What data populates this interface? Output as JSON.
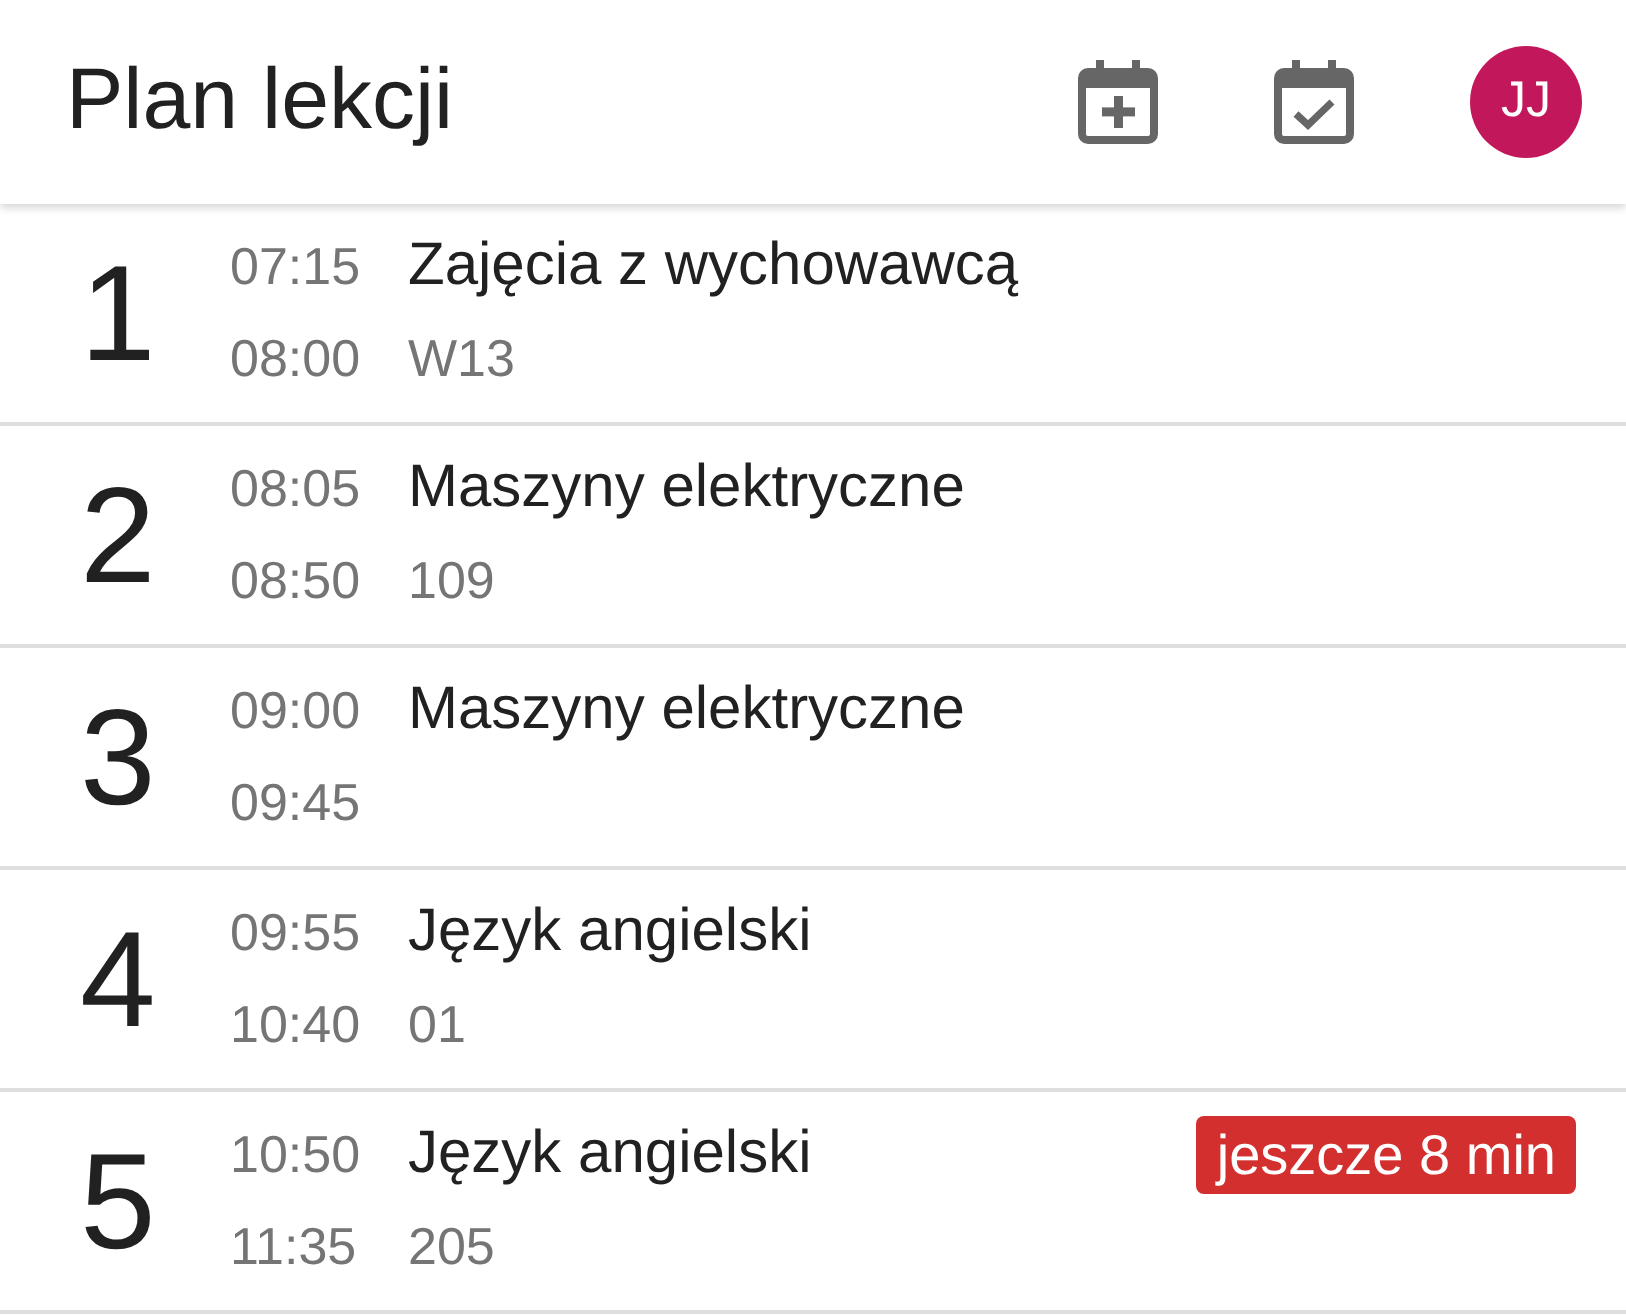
{
  "app_bar": {
    "title": "Plan lekcji",
    "avatar": {
      "initials": "JJ"
    }
  },
  "lessons": [
    {
      "number": "1",
      "start": "07:15",
      "end": "08:00",
      "subject": "Zajęcia z wychowawcą",
      "room": "W13"
    },
    {
      "number": "2",
      "start": "08:05",
      "end": "08:50",
      "subject": "Maszyny elektryczne",
      "room": "109"
    },
    {
      "number": "3",
      "start": "09:00",
      "end": "09:45",
      "subject": "Maszyny elektryczne"
    },
    {
      "number": "4",
      "start": "09:55",
      "end": "10:40",
      "subject": "Język angielski",
      "room": "01"
    },
    {
      "number": "5",
      "start": "10:50",
      "end": "11:35",
      "subject": "Język angielski",
      "room": "205",
      "badge": "jeszcze 8 min"
    }
  ]
}
